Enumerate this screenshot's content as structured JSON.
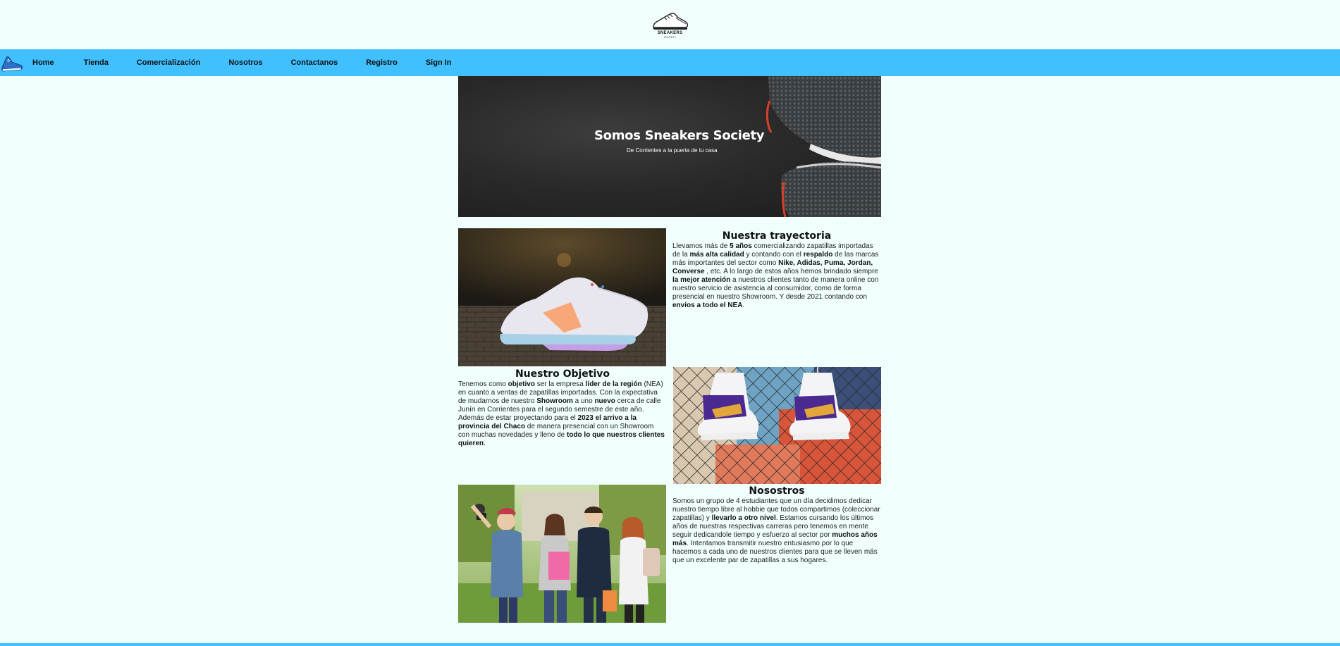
{
  "brand": {
    "name": "SNEAKERS",
    "sub": "SOCIETY"
  },
  "nav": {
    "items": [
      {
        "label": "Home"
      },
      {
        "label": "Tienda"
      },
      {
        "label": "Comercialización"
      },
      {
        "label": "Nosotros"
      },
      {
        "label": "Contactanos"
      },
      {
        "label": "Registro"
      },
      {
        "label": "Sign In"
      }
    ]
  },
  "hero": {
    "title": "Somos Sneakers Society",
    "subtitle": "De Corrientes a la puerta de tu casa"
  },
  "trayectoria": {
    "heading": "Nuestra trayectoria",
    "p1": "Llevamos más de ",
    "b1": "5 años",
    "p2": " comercializando zapatillas importadas de la ",
    "b2": "más alta calidad",
    "p3": " y contando con el ",
    "b3": "respaldo",
    "p4": " de las marcas más importantes del sector como ",
    "b4": "Nike, Adidas, Puma, Jordan, Converse",
    "p5": " , etc. A lo largo de estos años hemos brindado siempre ",
    "b5": "la mejor atención",
    "p6": " a nuestros clientes tanto de manera online con nuestro servicio de asistencia al consumidor, como de forma presencial en nuestro Showroom. Y desde 2021 contando con ",
    "b6": "envíos a todo el NEA",
    "p7": "."
  },
  "objetivo": {
    "heading": "Nuestro Objetivo",
    "p1": "Tenemos como ",
    "b1": "objetivo",
    "p2": " ser la empresa ",
    "b2": "líder de la región",
    "p3": " (NEA) en cuanto a ventas de zapatillas importadas. Con la expectativa de mudarnos de nuestro ",
    "b3": "Showroom",
    "p4": " a uno ",
    "b4": "nuevo",
    "p5": " cerca de calle Junín en Corrientes para el segundo semestre de este año. Además de estar proyectando para el ",
    "b5": "2023 el arrivo a la provincia del Chaco",
    "p6": " de manera presencial con un Showroom con muchas novedades y lleno de ",
    "b6": "todo lo que nuestros clientes quieren",
    "p7": "."
  },
  "nosotros": {
    "heading": "Nosostros",
    "p1": "Somos un grupo de 4 estudiantes que un día decidimos dedicar nuestro tiempo libre al hobbie que todos compartimos (coleccionar zapatillas) y ",
    "b1": "llevarlo a otro nivel",
    "p2": ". Estamos cursando los últimos años de nuestras respectivas carreras pero tenemos en mente seguir dedicandole tiempo y esfuerzo al sector por ",
    "b2": "muchos años más",
    "p3": ". Intentamos transmitir nuestro entusiasmo por lo que hacemos a cada uno de nuestros clientes para que se lleven más que un excelente par de zapatillas a sus hogares."
  },
  "colors": {
    "navbar": "#40c0ff",
    "background": "#f0fffe",
    "hero_bg": "#2a2a2a"
  },
  "icons": [
    "sneaker-logo",
    "sneaker-nav-icon"
  ]
}
